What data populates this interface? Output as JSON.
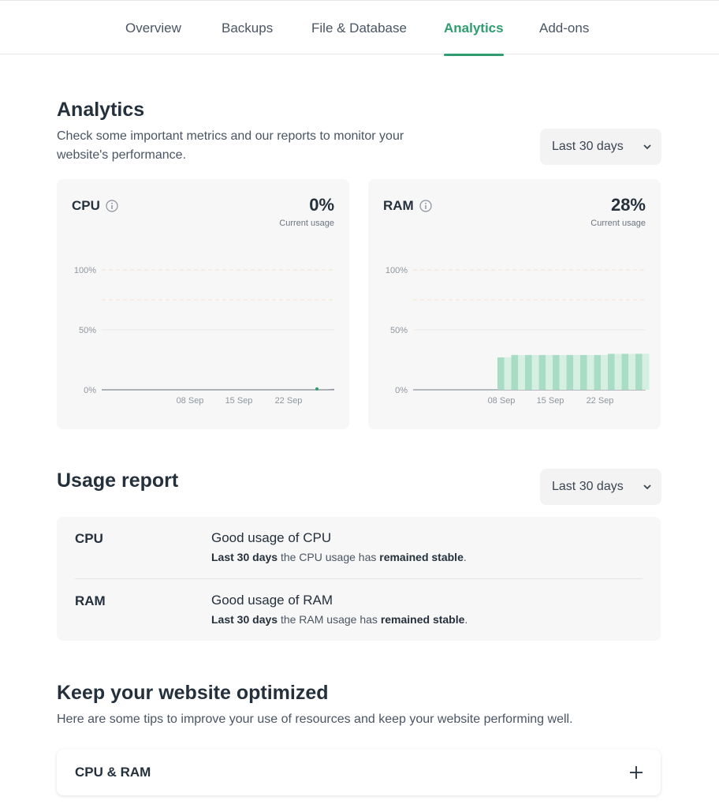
{
  "tabs": [
    {
      "label": "Overview"
    },
    {
      "label": "Backups"
    },
    {
      "label": "File & Database"
    },
    {
      "label": "Analytics",
      "active": true
    },
    {
      "label": "Add-ons"
    }
  ],
  "analytics": {
    "title": "Analytics",
    "description_line1": "Check some important metrics and our reports to monitor your",
    "description_line2": "website's performance.",
    "range_select": "Last 30 days"
  },
  "cards": {
    "cpu": {
      "label": "CPU",
      "value": "0%",
      "sub": "Current usage"
    },
    "ram": {
      "label": "RAM",
      "value": "28%",
      "sub": "Current usage"
    }
  },
  "chart_data": [
    {
      "type": "line",
      "title": "CPU",
      "y_ticks": [
        "100%",
        "50%",
        "0%"
      ],
      "x_ticks": [
        "08 Sep",
        "15 Sep",
        "22 Sep"
      ],
      "ylim": [
        0,
        100
      ],
      "values": [
        0,
        0,
        0,
        0,
        0,
        0,
        0,
        0,
        0,
        0,
        0,
        0,
        0,
        0,
        0,
        0,
        0,
        0,
        0,
        0,
        0,
        0,
        0,
        0,
        0,
        0,
        0,
        0,
        0,
        0.4
      ],
      "grid": true
    },
    {
      "type": "bar",
      "title": "RAM",
      "y_ticks": [
        "100%",
        "50%",
        "0%"
      ],
      "x_ticks": [
        "08 Sep",
        "15 Sep",
        "22 Sep"
      ],
      "ylim": [
        0,
        100
      ],
      "values": [
        27,
        29,
        29,
        29,
        29,
        29,
        29,
        29,
        30,
        30,
        30
      ],
      "grid": true
    }
  ],
  "usage": {
    "title": "Usage report",
    "range_select": "Last 30 days",
    "rows": [
      {
        "label": "CPU",
        "title": "Good usage of CPU",
        "period": "Last 30 days",
        "middle": " the CPU usage has ",
        "status": "remained stable",
        "end": "."
      },
      {
        "label": "RAM",
        "title": "Good usage of RAM",
        "period": "Last 30 days",
        "middle": " the RAM usage has ",
        "status": "remained stable",
        "end": "."
      }
    ]
  },
  "optimize": {
    "title": "Keep your website optimized",
    "description": "Here are some tips to improve your use of resources and keep your website performing well.",
    "accordion_label": "CPU & RAM"
  },
  "colors": {
    "accent": "#2f9d6f",
    "bar_fill": "#a9dcc5",
    "bar_fill_light": "#d6efe3"
  }
}
